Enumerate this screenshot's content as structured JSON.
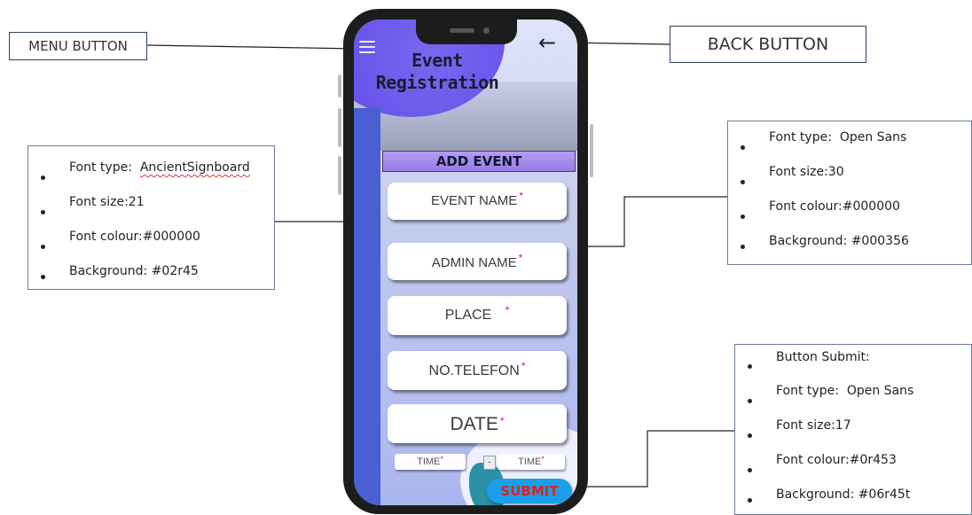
{
  "callouts": {
    "menu_button": "MENU BUTTON",
    "back_button": "BACK BUTTON"
  },
  "notes": {
    "title_font": {
      "items": [
        {
          "label": "Font type:",
          "value": "AncientSignboard"
        },
        {
          "label": "Font size:",
          "value": "21"
        },
        {
          "label": "Font colour:",
          "value": "#000000"
        },
        {
          "label": "Background:",
          "value": "#02r45"
        }
      ]
    },
    "field_font": {
      "items": [
        {
          "label": "Font type:",
          "value": "Open Sans"
        },
        {
          "label": "Font size:",
          "value": "30"
        },
        {
          "label": "Font colour:",
          "value": "#000000"
        },
        {
          "label": "Background:",
          "value": "#000356"
        }
      ]
    },
    "submit_button": {
      "heading": "Button Submit:",
      "items": [
        {
          "label": "Font type:",
          "value": "Open Sans"
        },
        {
          "label": "Font size:",
          "value": "17"
        },
        {
          "label": "Font colour:",
          "value": "#0r453"
        },
        {
          "label": "Background:",
          "value": "#06r45t"
        }
      ]
    }
  },
  "app": {
    "title_line1": "Event",
    "title_line2": "Registration",
    "menu_icon": "hamburger-icon",
    "back_icon": "←",
    "section_header": "ADD EVENT",
    "fields": {
      "event_name": "EVENT NAME",
      "admin_name": "ADMIN NAME",
      "place": "PLACE",
      "phone": "NO.TELEFON",
      "date": "DATE",
      "time_start": "TIME",
      "time_end": "TIME",
      "required_marker": "*"
    },
    "submit_label": "SUBMIT"
  },
  "colors": {
    "required": "#e02020",
    "submit_bg": "#1aa0e8",
    "header_bg": "#9a7ae6",
    "stripe": "#4a5fd3"
  }
}
